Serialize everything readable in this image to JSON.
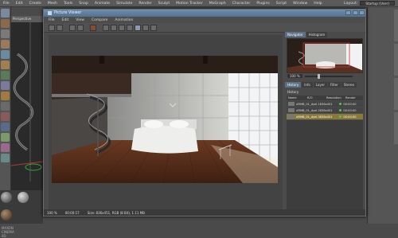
{
  "menubar": {
    "items": [
      "File",
      "Edit",
      "Create",
      "Mesh",
      "Tools",
      "Snap",
      "Animate",
      "Simulate",
      "Render",
      "Sculpt",
      "Motion Tracker",
      "MoGraph",
      "Character",
      "Plugins",
      "Script",
      "Window",
      "Help"
    ],
    "layout_label": "Layout:",
    "layout_value": "Startup (User)"
  },
  "viewport": {
    "label": "Perspective"
  },
  "picture_viewer": {
    "title": "Picture Viewer",
    "menu": [
      "File",
      "Edit",
      "View",
      "Compare",
      "Animation"
    ],
    "tabs_top": [
      "Navigator",
      "Histogram"
    ],
    "zoom_value": "100 %",
    "tabs_bottom": [
      "History",
      "Info",
      "Layer",
      "Filter",
      "Stereo"
    ],
    "history_label": "History",
    "history_columns": [
      "Name",
      "R/O",
      "Resolution",
      "Render"
    ],
    "history_rows": [
      {
        "name": "ARMB_01_dyel.1",
        "ro": "",
        "resolution": "836x451",
        "render": "00:00:00",
        "selected": false
      },
      {
        "name": "ARMB_01_dyel.2",
        "ro": "",
        "resolution": "836x451",
        "render": "00:00:00",
        "selected": false
      },
      {
        "name": "ARMB_01_dyel.3",
        "ro": "",
        "resolution": "836x451",
        "render": "00:00:00",
        "selected": true
      }
    ],
    "status": {
      "zoom": "100 %",
      "time": "00:00:17",
      "size": "Size: 836x451, RGB (8 Bit), 1.11 MB"
    }
  },
  "brand": {
    "logo_text": "MAXON CINEMA 4D"
  },
  "colors": {
    "accent_blue": "#5b6f85",
    "selected_row": "#8a7a3a",
    "status_green": "#5ac05a"
  }
}
